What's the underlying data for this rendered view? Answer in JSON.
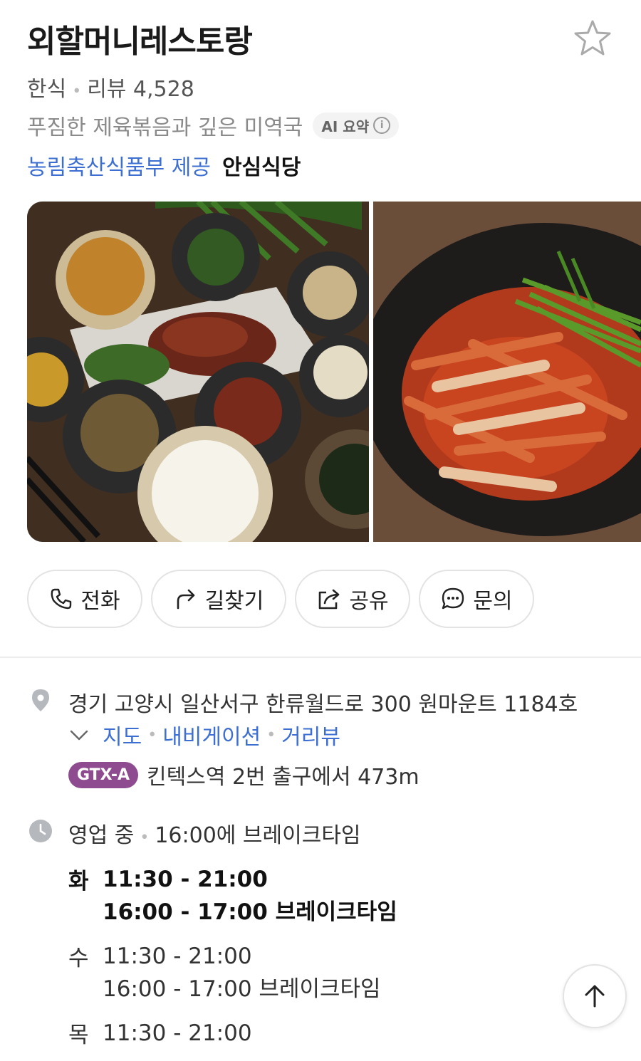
{
  "restaurant": {
    "name": "외할머니레스토랑",
    "category": "한식",
    "review_label": "리뷰 4,528",
    "summary": "푸짐한 제육볶음과 깊은 미역국",
    "ai_badge": "AI 요약",
    "provider": "농림축산식품부 제공",
    "certification": "안심식당"
  },
  "actions": [
    {
      "label": "전화",
      "icon": "phone-icon"
    },
    {
      "label": "길찾기",
      "icon": "directions-icon"
    },
    {
      "label": "공유",
      "icon": "share-icon"
    },
    {
      "label": "문의",
      "icon": "chat-icon"
    }
  ],
  "location": {
    "address": "경기 고양시 일산서구 한류월드로 300 원마운트 1184호",
    "links": [
      "지도",
      "내비게이션",
      "거리뷰"
    ],
    "transit_line": "GTX-A",
    "transit_text": "킨텍스역 2번 출구에서 473m"
  },
  "hours": {
    "status": "영업 중",
    "note": "16:00에 브레이크타임",
    "days": [
      {
        "day": "화",
        "time": "11:30 - 21:00",
        "break": "16:00 - 17:00 브레이크타임",
        "today": true
      },
      {
        "day": "수",
        "time": "11:30 - 21:00",
        "break": "16:00 - 17:00 브레이크타임",
        "today": false
      },
      {
        "day": "목",
        "time": "11:30 - 21:00",
        "break": "",
        "today": false
      }
    ]
  },
  "colors": {
    "link": "#3d6fd3",
    "gtx": "#8e4b8f"
  }
}
